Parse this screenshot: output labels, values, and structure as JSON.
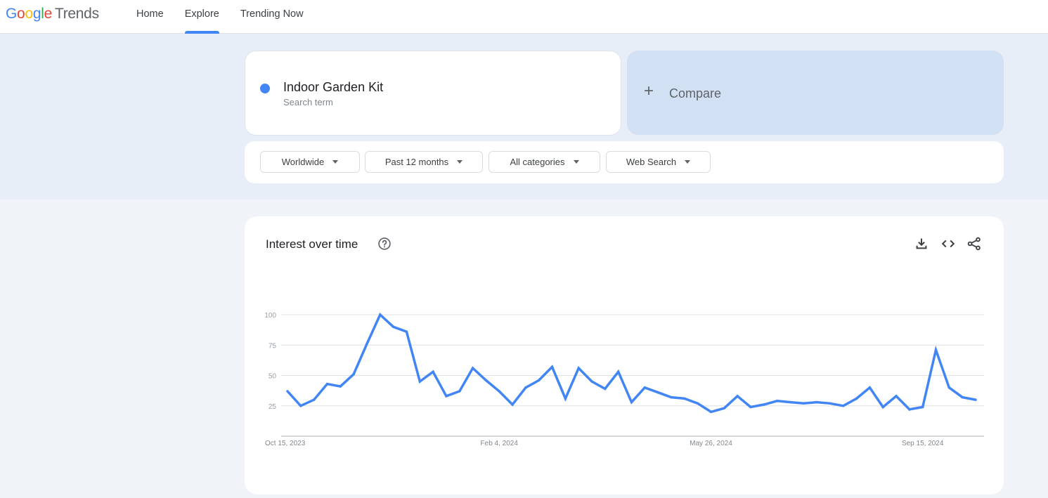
{
  "header": {
    "logo": {
      "google": [
        "G",
        "o",
        "o",
        "g",
        "l",
        "e"
      ],
      "product": "Trends"
    },
    "nav": [
      {
        "label": "Home",
        "active": false
      },
      {
        "label": "Explore",
        "active": true
      },
      {
        "label": "Trending Now",
        "active": false
      }
    ]
  },
  "search": {
    "term": "Indoor Garden Kit",
    "term_type": "Search term",
    "term_color": "#4285f4",
    "compare_label": "Compare",
    "compare_icon": "plus-icon"
  },
  "filters": [
    {
      "label": "Worldwide"
    },
    {
      "label": "Past 12 months"
    },
    {
      "label": "All categories"
    },
    {
      "label": "Web Search"
    }
  ],
  "widget": {
    "title": "Interest over time",
    "icons": [
      "help-icon",
      "download-icon",
      "embed-code-icon",
      "share-icon"
    ]
  },
  "chart_data": {
    "type": "line",
    "title": "Interest over time",
    "xlabel": "",
    "ylabel": "",
    "ylim": [
      0,
      100
    ],
    "yticks": [
      25,
      50,
      75,
      100
    ],
    "grid": true,
    "legend": "none",
    "series_color": "#4285f4",
    "x_tick_labels": [
      {
        "index": 0,
        "label": "Oct 15, 2023"
      },
      {
        "index": 16,
        "label": "Feb 4, 2024"
      },
      {
        "index": 32,
        "label": "May 26, 2024"
      },
      {
        "index": 48,
        "label": "Sep 15, 2024"
      }
    ],
    "series": [
      {
        "name": "Indoor Garden Kit",
        "values": [
          37,
          25,
          30,
          43,
          41,
          51,
          76,
          100,
          90,
          86,
          45,
          53,
          33,
          37,
          56,
          46,
          37,
          26,
          40,
          46,
          57,
          31,
          56,
          45,
          39,
          53,
          28,
          40,
          36,
          32,
          31,
          27,
          20,
          23,
          33,
          24,
          26,
          29,
          28,
          27,
          28,
          27,
          25,
          31,
          40,
          24,
          33,
          22,
          24,
          71,
          40,
          32,
          30
        ]
      }
    ]
  }
}
